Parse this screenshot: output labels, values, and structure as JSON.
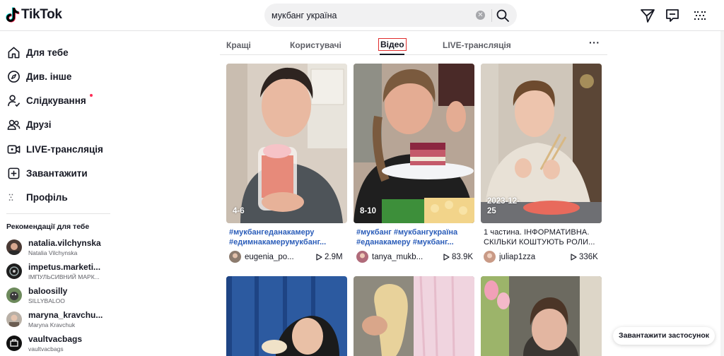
{
  "brand": {
    "name": "TikTok"
  },
  "search": {
    "query": "мукбанг україна",
    "clear_icon": "clear-icon",
    "submit_icon": "search-icon"
  },
  "header_icons": [
    "send-icon",
    "inbox-icon",
    "more-apps-icon"
  ],
  "sidebar": {
    "nav": [
      {
        "label": "Для тебе",
        "icon": "home-icon"
      },
      {
        "label": "Див. інше",
        "icon": "compass-icon"
      },
      {
        "label": "Слідкування",
        "icon": "following-icon",
        "dot": true
      },
      {
        "label": "Друзі",
        "icon": "friends-icon"
      },
      {
        "label": "LIVE-трансляція",
        "icon": "live-icon"
      },
      {
        "label": "Завантажити",
        "icon": "upload-icon"
      },
      {
        "label": "Профіль",
        "icon": "profile-icon"
      }
    ],
    "recommended_heading": "Рекомендації для тебе",
    "recommended": [
      {
        "username": "natalia.vilchynska",
        "nickname": "Natalia Vilchynska"
      },
      {
        "username": "impetus.marketi...",
        "nickname": "ІМПУЛЬСИВНИЙ МАРК..."
      },
      {
        "username": "baloosilly",
        "nickname": "SILLYBALOO"
      },
      {
        "username": "maryna_kravchu...",
        "nickname": "Maryna Kravchuk"
      },
      {
        "username": "vaultvacbags",
        "nickname": "vaultvacbags"
      }
    ]
  },
  "tabs": {
    "items": [
      "Кращі",
      "Користувачі",
      "Відео",
      "LIVE-трансляція"
    ],
    "active": "Відео",
    "more": "···"
  },
  "videos": [
    {
      "badge": "4-6",
      "desc": [
        "#мукбангеданакамеру",
        "#едимнакамерумукбанг..."
      ],
      "desc_style": "hashtag",
      "author": "eugenia_po...",
      "views": "2.9M"
    },
    {
      "badge": "8-10",
      "desc": [
        "#мукбанг #мукбангукраїна",
        "#еданакамеру #мукбанг..."
      ],
      "desc_style": "hashtag",
      "author": "tanya_mukb...",
      "views": "83.9K"
    },
    {
      "badge": "2023-12-25",
      "badge_lines": [
        "2023-12-",
        "25"
      ],
      "desc": [
        "1 частина. ІНФОРМАТИВНА.",
        "СКІЛЬКИ КОШТУЮТЬ РОЛИ..."
      ],
      "desc_style": "plain",
      "author": "juliap1zza",
      "views": "336K"
    }
  ],
  "download_app": "Завантажити застосунок",
  "colors": {
    "accent": "#fe2c55",
    "hashtag": "#2b5db9",
    "active_tab_box": "#e02b2b"
  }
}
